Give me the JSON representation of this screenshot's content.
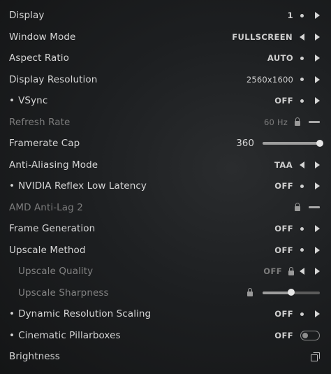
{
  "settings": [
    {
      "label": "Display",
      "value": "1"
    },
    {
      "label": "Window Mode",
      "value": "FULLSCREEN"
    },
    {
      "label": "Aspect Ratio",
      "value": "AUTO"
    },
    {
      "label": "Display Resolution",
      "value": "2560x1600"
    },
    {
      "label": "VSync",
      "value": "OFF",
      "bullet": "•"
    },
    {
      "label": "Refresh Rate",
      "value": "60 Hz"
    },
    {
      "label": "Framerate Cap",
      "value": "360",
      "level": 1.0
    },
    {
      "label": "Anti-Aliasing Mode",
      "value": "TAA"
    },
    {
      "label": "NVIDIA Reflex Low Latency",
      "value": "OFF",
      "bullet": "•"
    },
    {
      "label": "AMD Anti-Lag 2"
    },
    {
      "label": "Frame Generation",
      "value": "OFF"
    },
    {
      "label": "Upscale Method",
      "value": "OFF"
    },
    {
      "label": "Upscale Quality",
      "value": "OFF"
    },
    {
      "label": "Upscale Sharpness",
      "level": 0.5
    },
    {
      "label": "Dynamic Resolution Scaling",
      "value": "OFF",
      "bullet": "•"
    },
    {
      "label": "Cinematic Pillarboxes",
      "value": "OFF",
      "bullet": "•",
      "toggle_on": false
    },
    {
      "label": "Brightness"
    }
  ],
  "icons": {
    "next": "chevron-right-icon",
    "prev": "chevron-left-icon",
    "lock": "lock-icon",
    "copy": "copy-icon"
  }
}
